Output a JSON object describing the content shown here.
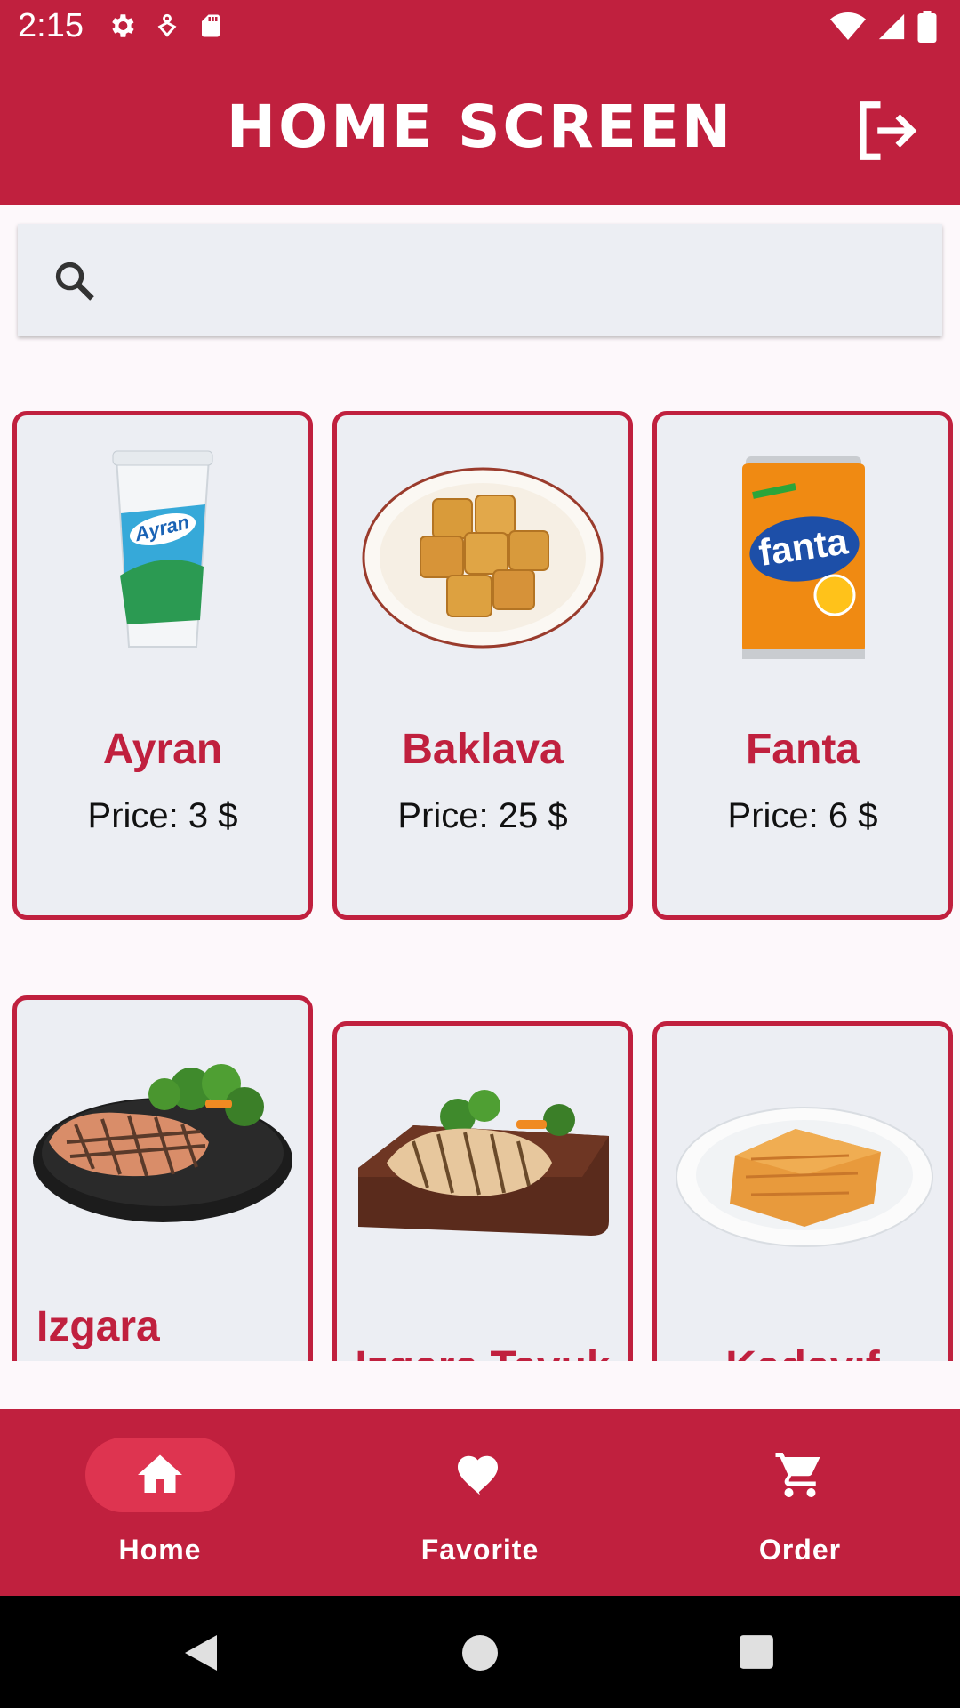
{
  "status_bar": {
    "time": "2:15"
  },
  "app_bar": {
    "title": "HOME SCREEN"
  },
  "search": {
    "placeholder": "",
    "value": ""
  },
  "products": [
    {
      "name": "Ayran",
      "price": "Price: 3 $",
      "icon": "ayran-cup-image"
    },
    {
      "name": "Baklava",
      "price": "Price: 25 $",
      "icon": "baklava-plate-image"
    },
    {
      "name": "Fanta",
      "price": "Price: 6 $",
      "icon": "fanta-can-image"
    },
    {
      "name": "Izgara",
      "price": "",
      "icon": "grilled-salmon-image"
    },
    {
      "name": "Izgara Tavuk",
      "price": "",
      "icon": "grilled-chicken-image"
    },
    {
      "name": "Kadayıf",
      "price": "",
      "icon": "kadayif-plate-image"
    }
  ],
  "bottom_nav": {
    "items": [
      {
        "label": "Home",
        "icon": "home-icon",
        "selected": true
      },
      {
        "label": "Favorite",
        "icon": "heart-icon",
        "selected": false
      },
      {
        "label": "Order",
        "icon": "cart-icon",
        "selected": false
      }
    ]
  },
  "colors": {
    "primary": "#c0203e",
    "card_bg": "#eceef3",
    "nav_pill": "#de3450",
    "background": "#fdf8fb"
  }
}
